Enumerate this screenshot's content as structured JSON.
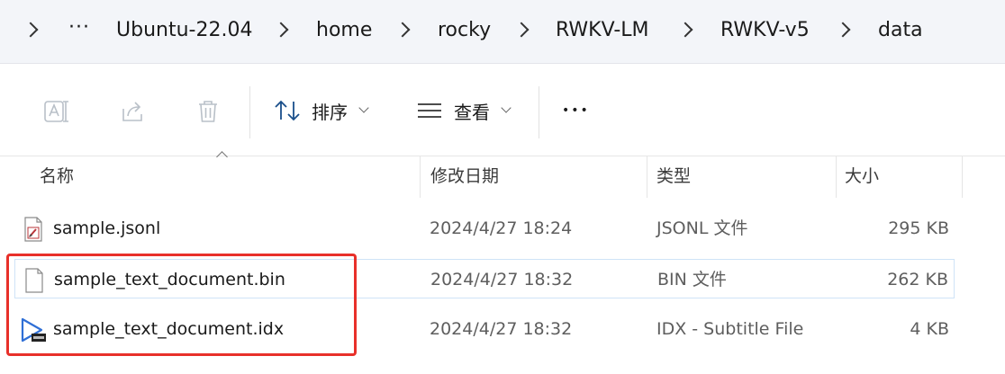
{
  "breadcrumb": {
    "overflow": "···",
    "items": [
      "Ubuntu-22.04",
      "home",
      "rocky",
      "RWKV-LM",
      "RWKV-v5",
      "data"
    ]
  },
  "toolbar": {
    "sort_label": "排序",
    "view_label": "查看",
    "more_label": "•••"
  },
  "columns": {
    "name": "名称",
    "modified": "修改日期",
    "type": "类型",
    "size": "大小"
  },
  "files": [
    {
      "name": "sample.jsonl",
      "modified": "2024/4/27 18:24",
      "type": "JSONL 文件",
      "size": "295 KB",
      "icon": "jsonl-file-icon"
    },
    {
      "name": "sample_text_document.bin",
      "modified": "2024/4/27 18:32",
      "type": "BIN 文件",
      "size": "262 KB",
      "icon": "blank-file-icon"
    },
    {
      "name": "sample_text_document.idx",
      "modified": "2024/4/27 18:32",
      "type": "IDX - Subtitle File",
      "size": "4 KB",
      "icon": "subtitle-file-icon"
    }
  ],
  "colors": {
    "highlight": "#e8302a",
    "selection_border": "#cfe3f7",
    "play_blue": "#2f6fd6"
  }
}
